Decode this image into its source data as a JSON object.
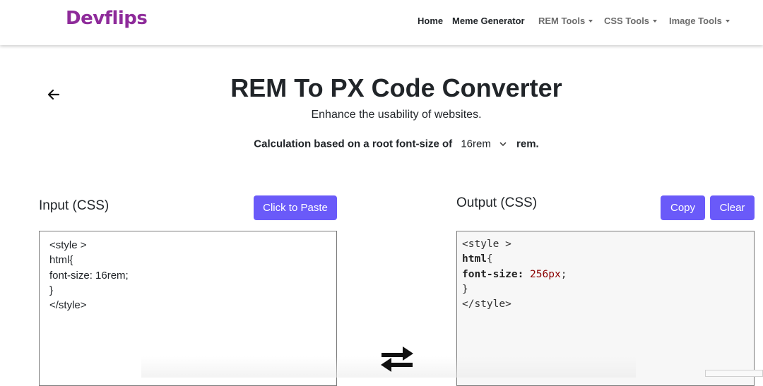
{
  "nav": {
    "logo": "Devflips",
    "links": [
      {
        "label": "Home"
      },
      {
        "label": "Meme Generator"
      },
      {
        "label": "REM Tools"
      },
      {
        "label": "CSS Tools"
      },
      {
        "label": "Image Tools"
      }
    ]
  },
  "header": {
    "title": "REM To PX Code Converter",
    "subtitle": "Enhance the usability of websites.",
    "calc_prefix": "Calculation based on a root font-size of",
    "root_value": "16rem",
    "calc_suffix": "rem."
  },
  "input": {
    "label": "Input (CSS)",
    "paste_button": "Click to Paste",
    "lines": [
      "<style >",
      "html{",
      "font-size: 16rem;",
      "}",
      "</style>"
    ]
  },
  "output": {
    "label": "Output (CSS)",
    "copy_button": "Copy",
    "clear_button": "Clear",
    "line1": "<style >",
    "line2_selector": "html",
    "line2_brace": "{",
    "line3_prop": "font-size:",
    "line3_value": "256px",
    "line3_end": ";",
    "line4": "}",
    "line5": "</style>"
  },
  "colors": {
    "accent": "#6a5af9",
    "logo": "#8e2b9a"
  },
  "icons": [
    "back-arrow-icon",
    "chevron-down-icon",
    "swap-arrows-icon"
  ]
}
